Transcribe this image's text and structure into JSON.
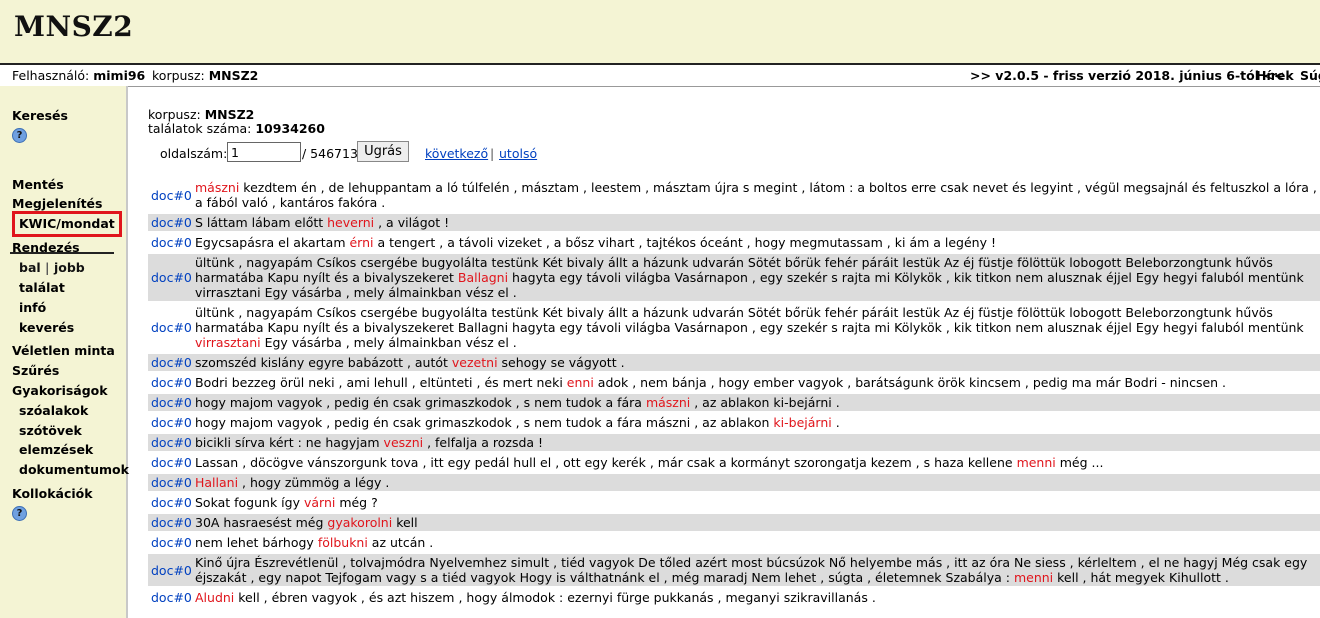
{
  "header": {
    "logo": "MNSZ2"
  },
  "infobar": {
    "user_label": "Felhasználó:",
    "user": "mimi96",
    "corpus_label": "korpusz:",
    "corpus": "MNSZ2",
    "version": ">> v2.0.5 - friss verzió 2018. június 6-tól <<",
    "news": "Hírek",
    "help": "Súg"
  },
  "sidebar": {
    "search": "Keresés",
    "save": "Mentés",
    "display": "Megjelenítés",
    "kwic": "KWIC/mondat",
    "sort": "Rendezés",
    "left": "bal",
    "divider": "|",
    "right": "jobb",
    "hit": "találat",
    "info": "infó",
    "mixed": "keverés",
    "random": "Véletlen minta",
    "filter": "Szűrés",
    "freq": "Gyakoriságok",
    "wordforms": "szóalakok",
    "stems": "szótövek",
    "analyses": "elemzések",
    "documents": "dokumentumok",
    "colloc": "Kollokációk",
    "help_glyph": "?"
  },
  "main": {
    "corpus_label": "korpusz:",
    "corpus": "MNSZ2",
    "hits_label": "találatok száma:",
    "hits": "10934260",
    "page_label": "oldalszám:",
    "page_value": "1",
    "page_total": "/ 546713",
    "go": "Ugrás",
    "next": "következő",
    "sep": "|",
    "last": "utolsó"
  },
  "rows": [
    {
      "doc": "doc#0",
      "pre": "",
      "kw": "mászni",
      "post": " kezdtem én , de lehuppantam a ló túlfelén , másztam , leestem , másztam újra s megint , látom : a boltos erre csak nevet és legyint , végül megsajnál és feltuszkol a lóra , a fából való , kantáros fakóra ."
    },
    {
      "doc": "doc#0",
      "pre": "S láttam lábam előtt ",
      "kw": "heverni",
      "post": " , a világot !"
    },
    {
      "doc": "doc#0",
      "pre": "Egycsapásra el akartam ",
      "kw": "érni",
      "post": " a tengert , a távoli vizeket , a bősz vihart , tajtékos óceánt , hogy megmutassam , ki ám a legény !"
    },
    {
      "doc": "doc#0",
      "pre": "ültünk , nagyapám Csíkos csergébe bugyolálta testünk Két bivaly állt a házunk udvarán Sötét bőrük fehér páráit lestük Az éj füstje fölöttük lobogott Beleborzongtunk hűvös harmatába Kapu nyílt és a bivalyszekeret ",
      "kw": "Ballagni",
      "post": " hagyta egy távoli világba Vasárnapon , egy szekér s rajta mi Kölykök , kik titkon nem alusznak éjjel Egy hegyi faluból mentünk virrasztani Egy vásárba , mely álmainkban vész el ."
    },
    {
      "doc": "doc#0",
      "pre": "ültünk , nagyapám Csíkos csergébe bugyolálta testünk Két bivaly állt a házunk udvarán Sötét bőrük fehér páráit lestük Az éj füstje fölöttük lobogott Beleborzongtunk hűvös harmatába Kapu nyílt és a bivalyszekeret Ballagni hagyta egy távoli világba Vasárnapon , egy szekér s rajta mi Kölykök , kik titkon nem alusznak éjjel Egy hegyi faluból mentünk ",
      "kw": "virrasztani",
      "post": " Egy vásárba , mely álmainkban vész el ."
    },
    {
      "doc": "doc#0",
      "pre": "szomszéd kislány egyre babázott , autót ",
      "kw": "vezetni",
      "post": " sehogy se vágyott ."
    },
    {
      "doc": "doc#0",
      "pre": "Bodri bezzeg örül neki , ami lehull , eltünteti , és mert neki ",
      "kw": "enni",
      "post": " adok , nem bánja , hogy ember vagyok , barátságunk örök kincsem , pedig ma már Bodri - nincsen ."
    },
    {
      "doc": "doc#0",
      "pre": "hogy majom vagyok , pedig én csak grimaszkodok , s nem tudok a fára ",
      "kw": "mászni",
      "post": " , az ablakon ki-bejárni ."
    },
    {
      "doc": "doc#0",
      "pre": "hogy majom vagyok , pedig én csak grimaszkodok , s nem tudok a fára mászni , az ablakon ",
      "kw": "ki-bejárni",
      "post": " ."
    },
    {
      "doc": "doc#0",
      "pre": "bicikli sírva kért : ne hagyjam ",
      "kw": "veszni",
      "post": " , felfalja a rozsda !"
    },
    {
      "doc": "doc#0",
      "pre": "Lassan , döcögve vánszorgunk tova , itt egy pedál hull el , ott egy kerék , már csak a kormányt szorongatja kezem , s haza kellene ",
      "kw": "menni",
      "post": " még ..."
    },
    {
      "doc": "doc#0",
      "pre": "",
      "kw": "Hallani",
      "post": " , hogy zümmög a légy ."
    },
    {
      "doc": "doc#0",
      "pre": "Sokat fogunk így ",
      "kw": "várni",
      "post": " még ?"
    },
    {
      "doc": "doc#0",
      "pre": "30A hasraesést még ",
      "kw": "gyakorolni",
      "post": " kell"
    },
    {
      "doc": "doc#0",
      "pre": "nem lehet bárhogy ",
      "kw": "fölbukni",
      "post": " az utcán ."
    },
    {
      "doc": "doc#0",
      "pre": "Kinő újra Észrevétlenül , tolvajmódra Nyelvemhez simult , tiéd vagyok De tőled azért most búcsúzok Nő helyembe más , itt az óra Ne siess , kérleltem , el ne hagyj Még csak egy éjszakát , egy napot Tejfogam vagy s a tiéd vagyok Hogy is válthatnánk el , még maradj Nem lehet , súgta , életemnek Szabálya : ",
      "kw": "menni",
      "post": " kell , hát megyek Kihullott ."
    },
    {
      "doc": "doc#0",
      "pre": "",
      "kw": "Aludni",
      "post": " kell , ébren vagyok , és azt hiszem , hogy álmodok : ezernyi fürge pukkanás , meganyi szikravillanás ."
    }
  ]
}
